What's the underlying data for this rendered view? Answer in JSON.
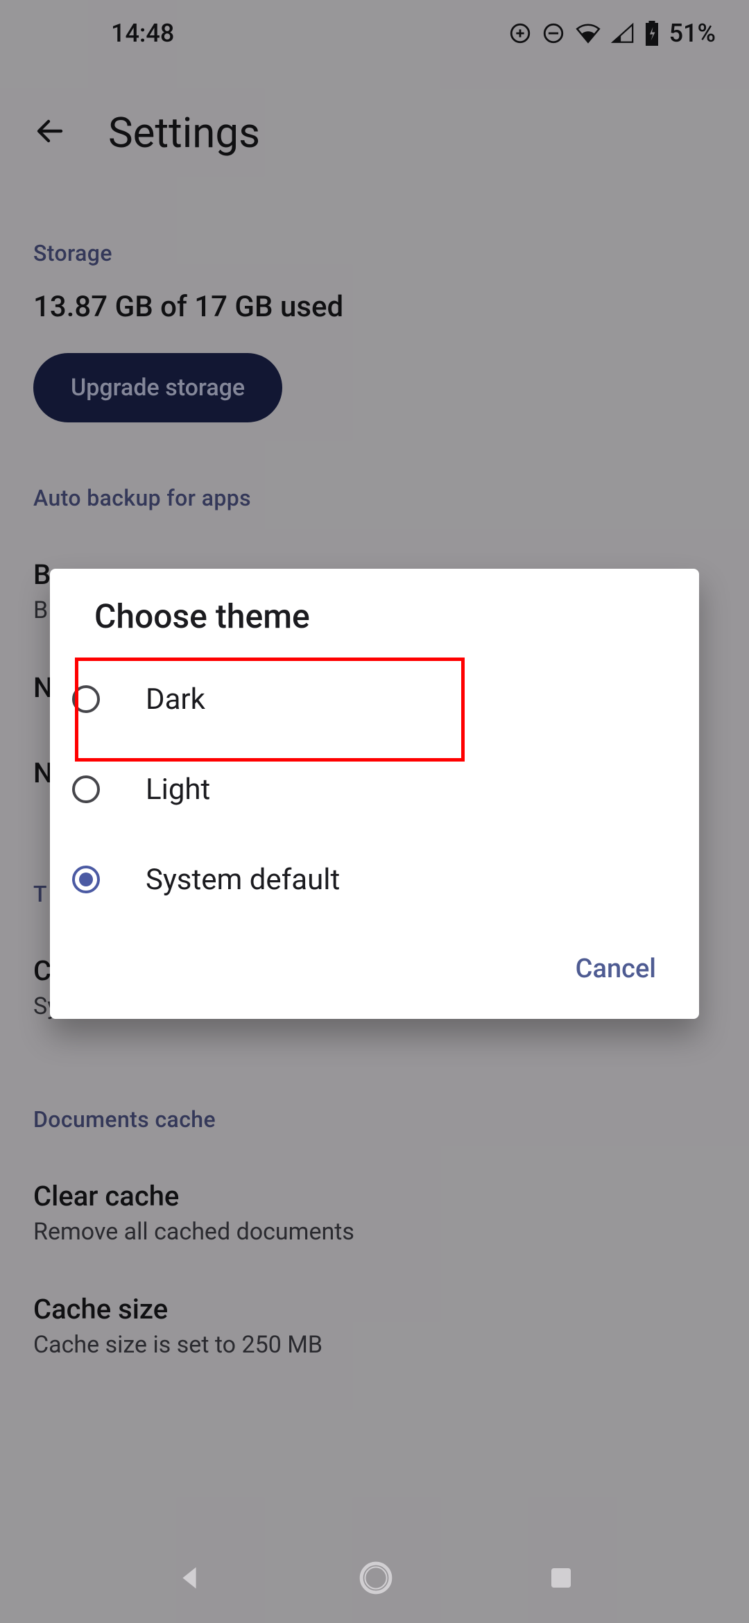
{
  "status": {
    "time": "14:48",
    "battery": "51%"
  },
  "appbar": {
    "title": "Settings"
  },
  "storage": {
    "header": "Storage",
    "used": "13.87 GB of 17 GB used",
    "upgrade": "Upgrade storage"
  },
  "autobackup": {
    "header": "Auto backup for apps",
    "pref1_title_visible": "B",
    "pref1_sub_visible": "B",
    "pref2_title_visible": "N",
    "pref3_title_visible": "N"
  },
  "theme_section": {
    "header": "T",
    "pref_title": "Choose theme",
    "pref_sub": "System default"
  },
  "cache": {
    "header": "Documents cache",
    "clear_title": "Clear cache",
    "clear_sub": "Remove all cached documents",
    "size_title": "Cache size",
    "size_sub": "Cache size is set to 250 MB"
  },
  "dialog": {
    "title": "Choose theme",
    "options": {
      "dark": "Dark",
      "light": "Light",
      "system": "System default"
    },
    "selected": "system",
    "cancel": "Cancel"
  }
}
